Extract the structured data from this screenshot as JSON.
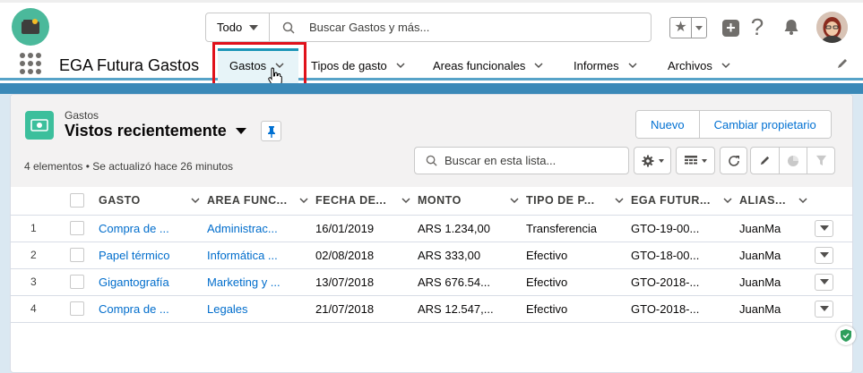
{
  "header": {
    "search_scope": "Todo",
    "search_placeholder": "Buscar Gastos y más..."
  },
  "nav": {
    "app_name": "EGA Futura Gastos",
    "items": [
      {
        "label": "Gastos",
        "active": true
      },
      {
        "label": "Tipos de gasto"
      },
      {
        "label": "Areas funcionales"
      },
      {
        "label": "Informes"
      },
      {
        "label": "Archivos"
      }
    ]
  },
  "list": {
    "object_label": "Gastos",
    "view_name": "Vistos recientemente",
    "status": "4 elementos • Se actualizó hace 26 minutos",
    "new_button": "Nuevo",
    "change_owner_button": "Cambiar propietario",
    "search_placeholder": "Buscar en esta lista...",
    "columns": [
      "GASTO",
      "AREA FUNC...",
      "FECHA DE...",
      "MONTO",
      "TIPO DE P...",
      "EGA FUTUR...",
      "ALIAS..."
    ],
    "rows": [
      {
        "num": "1",
        "gasto": "Compra de ...",
        "area": "Administrac...",
        "fecha": "16/01/2019",
        "monto": "ARS 1.234,00",
        "tipo": "Transferencia",
        "ega": "GTO-19-00...",
        "alias": "JuanMa"
      },
      {
        "num": "2",
        "gasto": "Papel térmico",
        "area": "Informática ...",
        "fecha": "02/08/2018",
        "monto": "ARS 333,00",
        "tipo": "Efectivo",
        "ega": "GTO-18-00...",
        "alias": "JuanMa"
      },
      {
        "num": "3",
        "gasto": "Gigantografía",
        "area": "Marketing y ...",
        "fecha": "13/07/2018",
        "monto": "ARS 676.54...",
        "tipo": "Efectivo",
        "ega": "GTO-2018-...",
        "alias": "JuanMa"
      },
      {
        "num": "4",
        "gasto": "Compra de ...",
        "area": "Legales",
        "fecha": "21/07/2018",
        "monto": "ARS 12.547,...",
        "tipo": "Efectivo",
        "ega": "GTO-2018-...",
        "alias": "JuanMa"
      }
    ]
  },
  "colors": {
    "brand_teal": "#4bb99b",
    "link_blue": "#006dcc",
    "highlight_red": "#e0121b",
    "nav_accent": "#1b96b7"
  }
}
